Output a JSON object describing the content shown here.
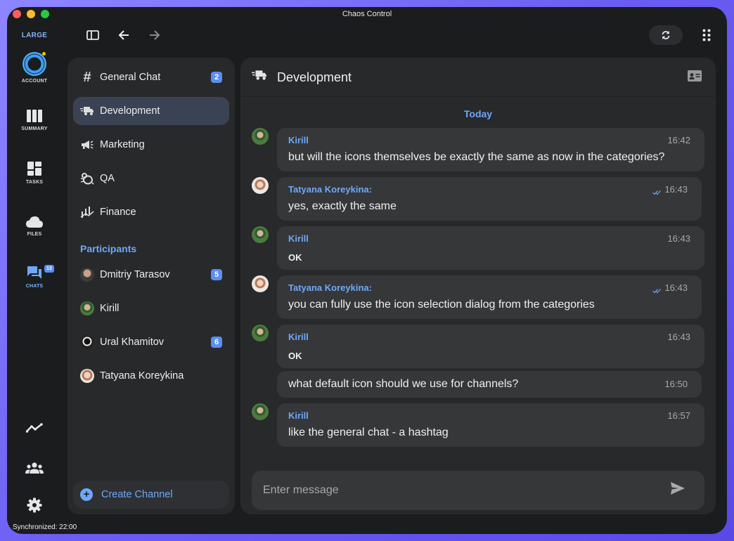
{
  "window": {
    "title": "Chaos Control"
  },
  "rail": {
    "size_label": "LARGE",
    "items": [
      {
        "label": "ACCOUNT",
        "icon": "account-logo-icon"
      },
      {
        "label": "SUMMARY",
        "icon": "columns-icon"
      },
      {
        "label": "TASKS",
        "icon": "dashboard-icon"
      },
      {
        "label": "FILES",
        "icon": "cloud-icon"
      },
      {
        "label": "CHATS",
        "icon": "chat-icon",
        "badge": "13"
      }
    ],
    "bottom_icons": [
      "trend-icon",
      "people-icon",
      "settings-icon"
    ]
  },
  "channels": {
    "items": [
      {
        "label": "General Chat",
        "icon": "hashtag-icon",
        "count": "2"
      },
      {
        "label": "Development",
        "icon": "truck-fast-icon",
        "active": true
      },
      {
        "label": "Marketing",
        "icon": "megaphone-icon"
      },
      {
        "label": "QA",
        "icon": "bug-icon"
      },
      {
        "label": "Finance",
        "icon": "finance-icon"
      }
    ],
    "participants_title": "Participants",
    "participants": [
      {
        "name": "Dmitriy Tarasov",
        "count": "5"
      },
      {
        "name": "Kirill"
      },
      {
        "name": "Ural Khamitov",
        "count": "6"
      },
      {
        "name": "Tatyana Koreykina"
      }
    ],
    "create_label": "Create Channel"
  },
  "chat": {
    "title": "Development",
    "date_separator": "Today",
    "messages": [
      {
        "sender": "Kirill",
        "time": "16:42",
        "text": "but will the icons themselves be exactly the same as now in the categories?"
      },
      {
        "sender": "Tatyana Koreykina:",
        "time": "16:43",
        "text": "yes, exactly the same",
        "read": true
      },
      {
        "sender": "Kirill",
        "time": "16:43",
        "text": "OK"
      },
      {
        "sender": "Tatyana Koreykina:",
        "time": "16:43",
        "text": "you can fully use the icon selection dialog from the categories",
        "read": true
      },
      {
        "sender": "Kirill",
        "time": "16:43",
        "text": "OK"
      },
      {
        "sender": "",
        "time": "16:50",
        "text": "what default icon should we use for channels?"
      },
      {
        "sender": "Kirill",
        "time": "16:57",
        "text": "like the general chat - a hashtag"
      }
    ],
    "composer_placeholder": "Enter message"
  },
  "status": {
    "text": "Synchronized: 22:00"
  },
  "colors": {
    "accent": "#6ea8fb",
    "badge": "#5b8ff0",
    "window_bg": "#1b1c1e",
    "panel_bg": "#28292b",
    "bubble_bg": "#363739"
  }
}
